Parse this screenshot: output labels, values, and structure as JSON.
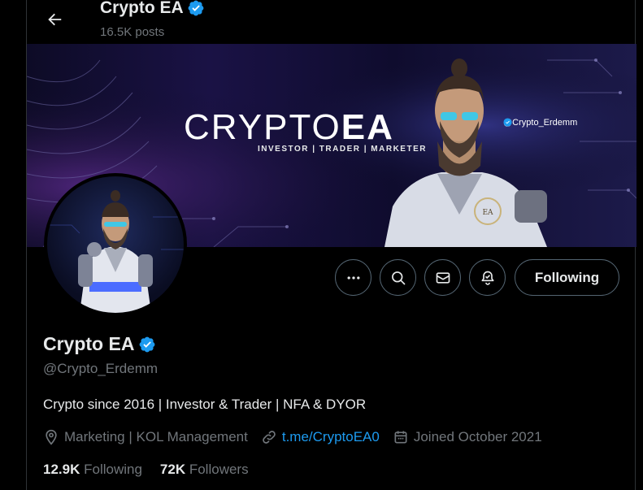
{
  "header": {
    "name": "Crypto EA",
    "posts": "16.5K posts"
  },
  "banner": {
    "brand_light": "CRYPTO",
    "brand_bold": "EA",
    "tagline": "INVESTOR | TRADER | MARKETER",
    "handle": "@Crypto_Erdemm",
    "emblem": "EA"
  },
  "actions": {
    "follow_label": "Following"
  },
  "profile": {
    "name": "Crypto EA",
    "handle": "@Crypto_Erdemm",
    "bio": "Crypto since 2016 | Investor & Trader | NFA & DYOR",
    "location": "Marketing | KOL Management",
    "link": "t.me/CryptoEA0",
    "joined": "Joined October 2021"
  },
  "stats": {
    "following_count": "12.9K",
    "following_label": "Following",
    "followers_count": "72K",
    "followers_label": "Followers"
  },
  "colors": {
    "background": "#000000",
    "accent": "#1d9bf0",
    "verified": "#1d9bf0",
    "muted": "#71767b",
    "border": "#536471"
  }
}
